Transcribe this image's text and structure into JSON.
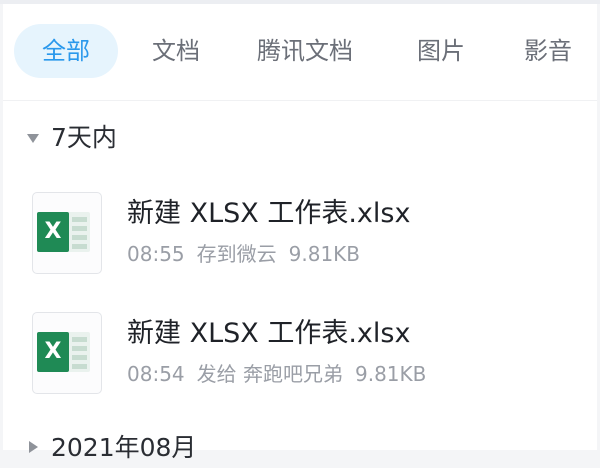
{
  "tabs": [
    {
      "label": "全部",
      "active": true
    },
    {
      "label": "文档",
      "active": false
    },
    {
      "label": "腾讯文档",
      "active": false
    },
    {
      "label": "图片",
      "active": false
    },
    {
      "label": "影音",
      "active": false
    }
  ],
  "colors": {
    "accent": "#2a98ec",
    "accent_bg": "#e6f4fd",
    "excel_green": "#1f8a55"
  },
  "sections": [
    {
      "title": "7天内",
      "expanded": true,
      "files": [
        {
          "name": "新建 XLSX 工作表.xlsx",
          "icon": "excel-file-icon",
          "time": "08:55",
          "action": "存到微云",
          "size": "9.81KB"
        },
        {
          "name": "新建 XLSX 工作表.xlsx",
          "icon": "excel-file-icon",
          "time": "08:54",
          "action": "发给 奔跑吧兄弟",
          "size": "9.81KB"
        }
      ]
    },
    {
      "title": "2021年08月",
      "expanded": false,
      "files": []
    }
  ]
}
